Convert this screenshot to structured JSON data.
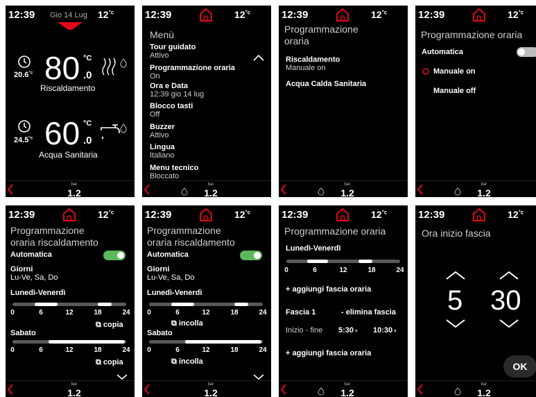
{
  "common": {
    "time": "12:39",
    "outdoor_temp": "12",
    "temp_unit": "°c",
    "pressure_unit": "bar",
    "pressure": "1.2",
    "accent_color": "#e1061b",
    "toggle_on_color": "#5cb85c"
  },
  "s1": {
    "date": "Gio 14 Lug",
    "heating": {
      "setpoint": "80",
      "decimal": ".0",
      "unit": "°C",
      "current": "20.6",
      "current_unit": "°c",
      "label": "Riscaldamento"
    },
    "dhw": {
      "setpoint": "60",
      "decimal": ".0",
      "unit": "°C",
      "current": "24.5",
      "current_unit": "°c",
      "label": "Acqua Sanitaria"
    }
  },
  "s2": {
    "title": "Menù",
    "items": [
      {
        "label": "Tour guidato",
        "value": "Attivo"
      },
      {
        "label": "Programmazione oraria",
        "value": "On"
      },
      {
        "label": "Ora e Data",
        "value": "12:39 gio 14 lug"
      },
      {
        "label": "Blocco tasti",
        "value": "Off"
      },
      {
        "label": "Buzzer",
        "value": "Attivo"
      },
      {
        "label": "Lingua",
        "value": "Italiano"
      },
      {
        "label": "Menu tecnico",
        "value": "Bloccato"
      }
    ]
  },
  "s3": {
    "title_l1": "Programmazione",
    "title_l2": "oraria",
    "heating_label": "Riscaldamento",
    "heating_value": "Manuale on",
    "dhw_label": "Acqua Calda Sanitaria"
  },
  "s4": {
    "title": "Programmazione oraria",
    "automatic": "Automatica",
    "manual_on": "Manuale on",
    "manual_off": "Manuale off"
  },
  "s5": {
    "title_l1": "Programmazione",
    "title_l2": "oraria riscaldamento",
    "automatic": "Automatica",
    "days_label": "Giorni",
    "days_value": "Lu-Ve, Sa, Do",
    "weekdays": "Lunedì-Venerdì",
    "saturday": "Sabato",
    "copy": "copia",
    "ticks": [
      "0",
      "6",
      "12",
      "18",
      "24"
    ]
  },
  "s6": {
    "title_l1": "Programmazione",
    "title_l2": "oraria riscaldamento",
    "automatic": "Automatica",
    "days_label": "Giorni",
    "days_value": "Lu-Ve, Sa, Do",
    "weekdays": "Lunedì-Venerdì",
    "saturday": "Sabato",
    "paste": "incolla",
    "ticks": [
      "0",
      "6",
      "12",
      "18",
      "24"
    ]
  },
  "s7": {
    "title": "Programmazione oraria",
    "weekdays": "Lunedì-Venerdì",
    "ticks": [
      "0",
      "6",
      "12",
      "18",
      "24"
    ],
    "add_slot": "+ aggiungi fascia oraria",
    "slot_label": "Fascia 1",
    "delete_slot": "- elimina fascia",
    "start_end": "Inizio - fine",
    "start": "5:30",
    "end": "10:30",
    "add_slot_2": "+ aggiungi fascia oraria"
  },
  "s8": {
    "title": "Ora inizio fascia",
    "hours": "5",
    "minutes": "30",
    "ok": "OK"
  }
}
